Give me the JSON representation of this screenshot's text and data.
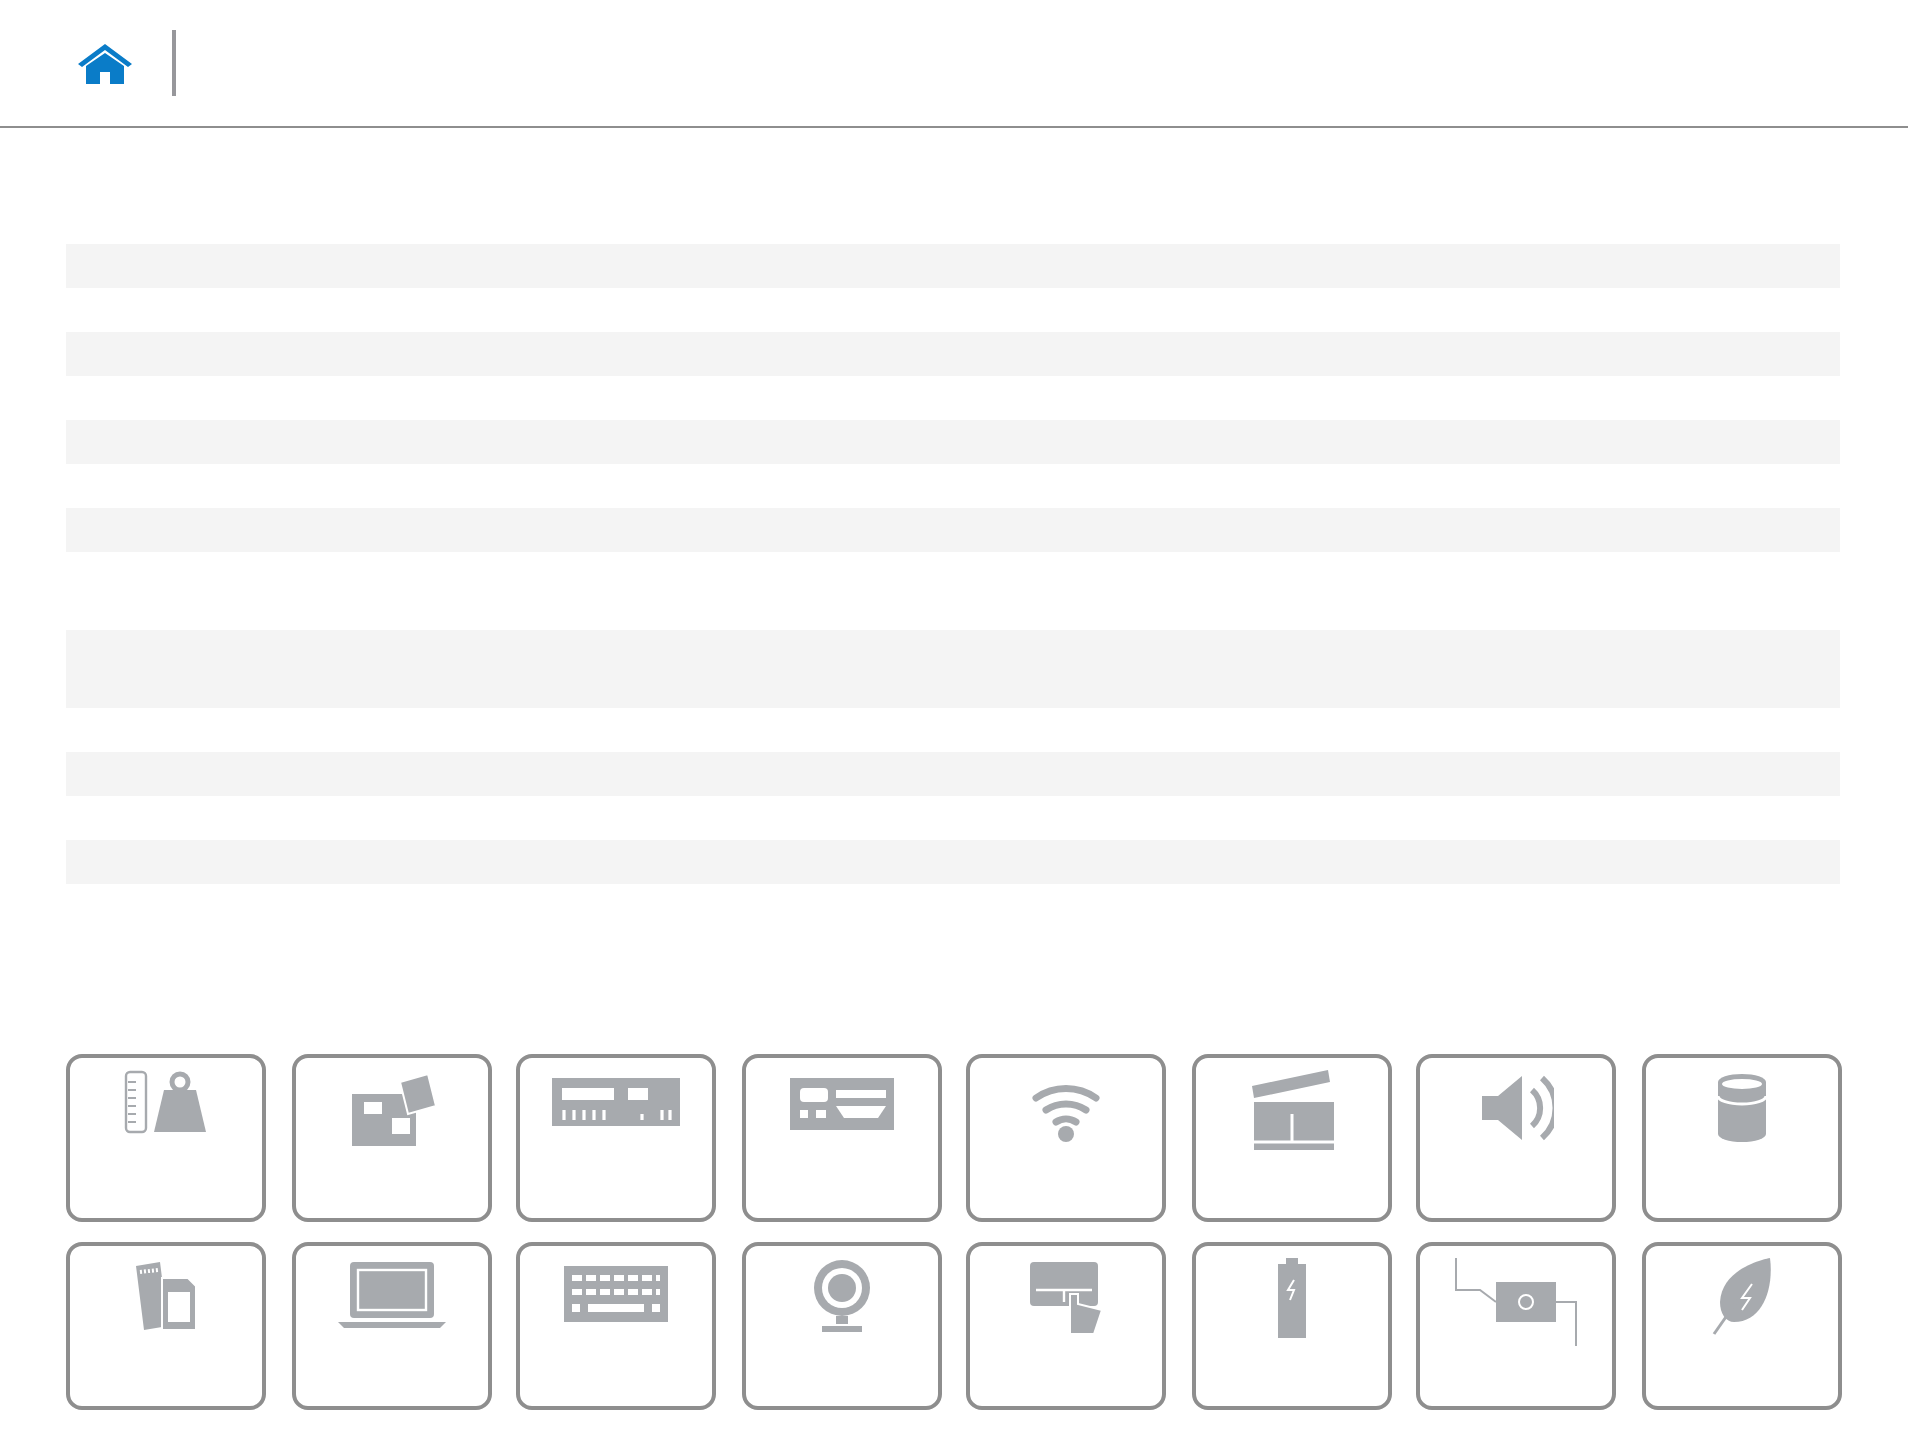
{
  "table": {
    "rows": [
      {
        "kind": "single"
      },
      {
        "kind": "single"
      },
      {
        "kind": "single"
      },
      {
        "kind": "single"
      },
      {
        "kind": "single"
      },
      {
        "kind": "single"
      },
      {
        "kind": "single"
      },
      {
        "kind": "double"
      },
      {
        "kind": "double"
      },
      {
        "kind": "single"
      },
      {
        "kind": "single"
      },
      {
        "kind": "single"
      },
      {
        "kind": "single"
      }
    ]
  },
  "tiles": [
    {
      "kind": "weight"
    },
    {
      "kind": "board"
    },
    {
      "kind": "panel"
    },
    {
      "kind": "ports"
    },
    {
      "kind": "wifi"
    },
    {
      "kind": "clapper"
    },
    {
      "kind": "speaker"
    },
    {
      "kind": "cylinder"
    },
    {
      "kind": "card"
    },
    {
      "kind": "laptop"
    },
    {
      "kind": "keyboard"
    },
    {
      "kind": "webcam"
    },
    {
      "kind": "touchpad"
    },
    {
      "kind": "battery"
    },
    {
      "kind": "adapter"
    },
    {
      "kind": "leaf"
    }
  ]
}
